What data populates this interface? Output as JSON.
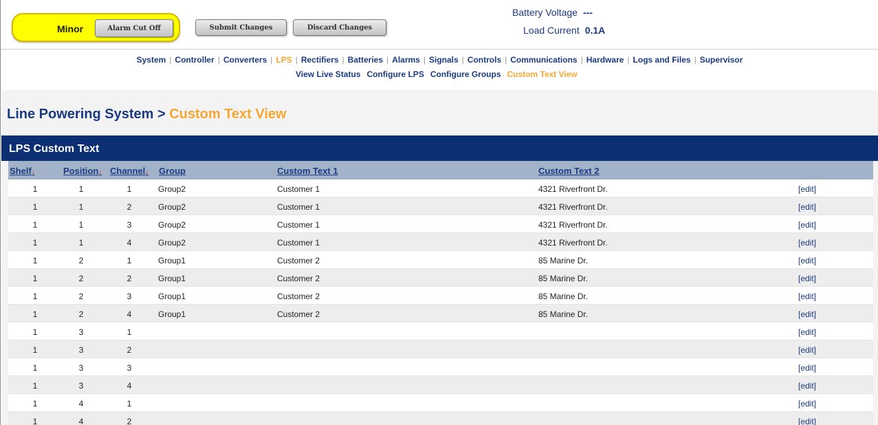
{
  "header": {
    "alarm_level": "Minor",
    "alarm_cut_off_label": "Alarm Cut Off",
    "submit_label": "Submit Changes",
    "discard_label": "Discard Changes",
    "battery_voltage_label": "Battery Voltage",
    "battery_voltage_value": "---",
    "load_current_label": "Load Current",
    "load_current_value": "0.1A",
    "alarm_color": "#ffff00"
  },
  "nav": {
    "items": [
      "System",
      "Controller",
      "Converters",
      "LPS",
      "Rectifiers",
      "Batteries",
      "Alarms",
      "Signals",
      "Controls",
      "Communications",
      "Hardware",
      "Logs and Files",
      "Supervisor"
    ],
    "active": "LPS",
    "subitems": [
      "View Live Status",
      "Configure LPS",
      "Configure Groups",
      "Custom Text View"
    ],
    "sub_active": "Custom Text View"
  },
  "page": {
    "title_parent": "Line Powering System",
    "title_separator": ">",
    "title_current": "Custom Text View",
    "panel_title": "LPS Custom Text"
  },
  "table": {
    "columns": {
      "shelf": "Shelf",
      "position": "Position",
      "channel": "Channel",
      "group": "Group",
      "custom_text_1": "Custom Text 1",
      "custom_text_2": "Custom Text 2"
    },
    "edit_label": "[edit]",
    "rows": [
      {
        "shelf": "1",
        "position": "1",
        "channel": "1",
        "group": "Group2",
        "text1": "Customer 1",
        "text2": "4321 Riverfront Dr."
      },
      {
        "shelf": "1",
        "position": "1",
        "channel": "2",
        "group": "Group2",
        "text1": "Customer 1",
        "text2": "4321 Riverfront Dr."
      },
      {
        "shelf": "1",
        "position": "1",
        "channel": "3",
        "group": "Group2",
        "text1": "Customer 1",
        "text2": "4321 Riverfront Dr."
      },
      {
        "shelf": "1",
        "position": "1",
        "channel": "4",
        "group": "Group2",
        "text1": "Customer 1",
        "text2": "4321 Riverfront Dr."
      },
      {
        "shelf": "1",
        "position": "2",
        "channel": "1",
        "group": "Group1",
        "text1": "Customer 2",
        "text2": "85 Marine Dr."
      },
      {
        "shelf": "1",
        "position": "2",
        "channel": "2",
        "group": "Group1",
        "text1": "Customer 2",
        "text2": "85 Marine Dr."
      },
      {
        "shelf": "1",
        "position": "2",
        "channel": "3",
        "group": "Group1",
        "text1": "Customer 2",
        "text2": "85 Marine Dr."
      },
      {
        "shelf": "1",
        "position": "2",
        "channel": "4",
        "group": "Group1",
        "text1": "Customer 2",
        "text2": "85 Marine Dr."
      },
      {
        "shelf": "1",
        "position": "3",
        "channel": "1",
        "group": "",
        "text1": "",
        "text2": ""
      },
      {
        "shelf": "1",
        "position": "3",
        "channel": "2",
        "group": "",
        "text1": "",
        "text2": ""
      },
      {
        "shelf": "1",
        "position": "3",
        "channel": "3",
        "group": "",
        "text1": "",
        "text2": ""
      },
      {
        "shelf": "1",
        "position": "3",
        "channel": "4",
        "group": "",
        "text1": "",
        "text2": ""
      },
      {
        "shelf": "1",
        "position": "4",
        "channel": "1",
        "group": "",
        "text1": "",
        "text2": ""
      },
      {
        "shelf": "1",
        "position": "4",
        "channel": "2",
        "group": "",
        "text1": "",
        "text2": ""
      }
    ]
  }
}
